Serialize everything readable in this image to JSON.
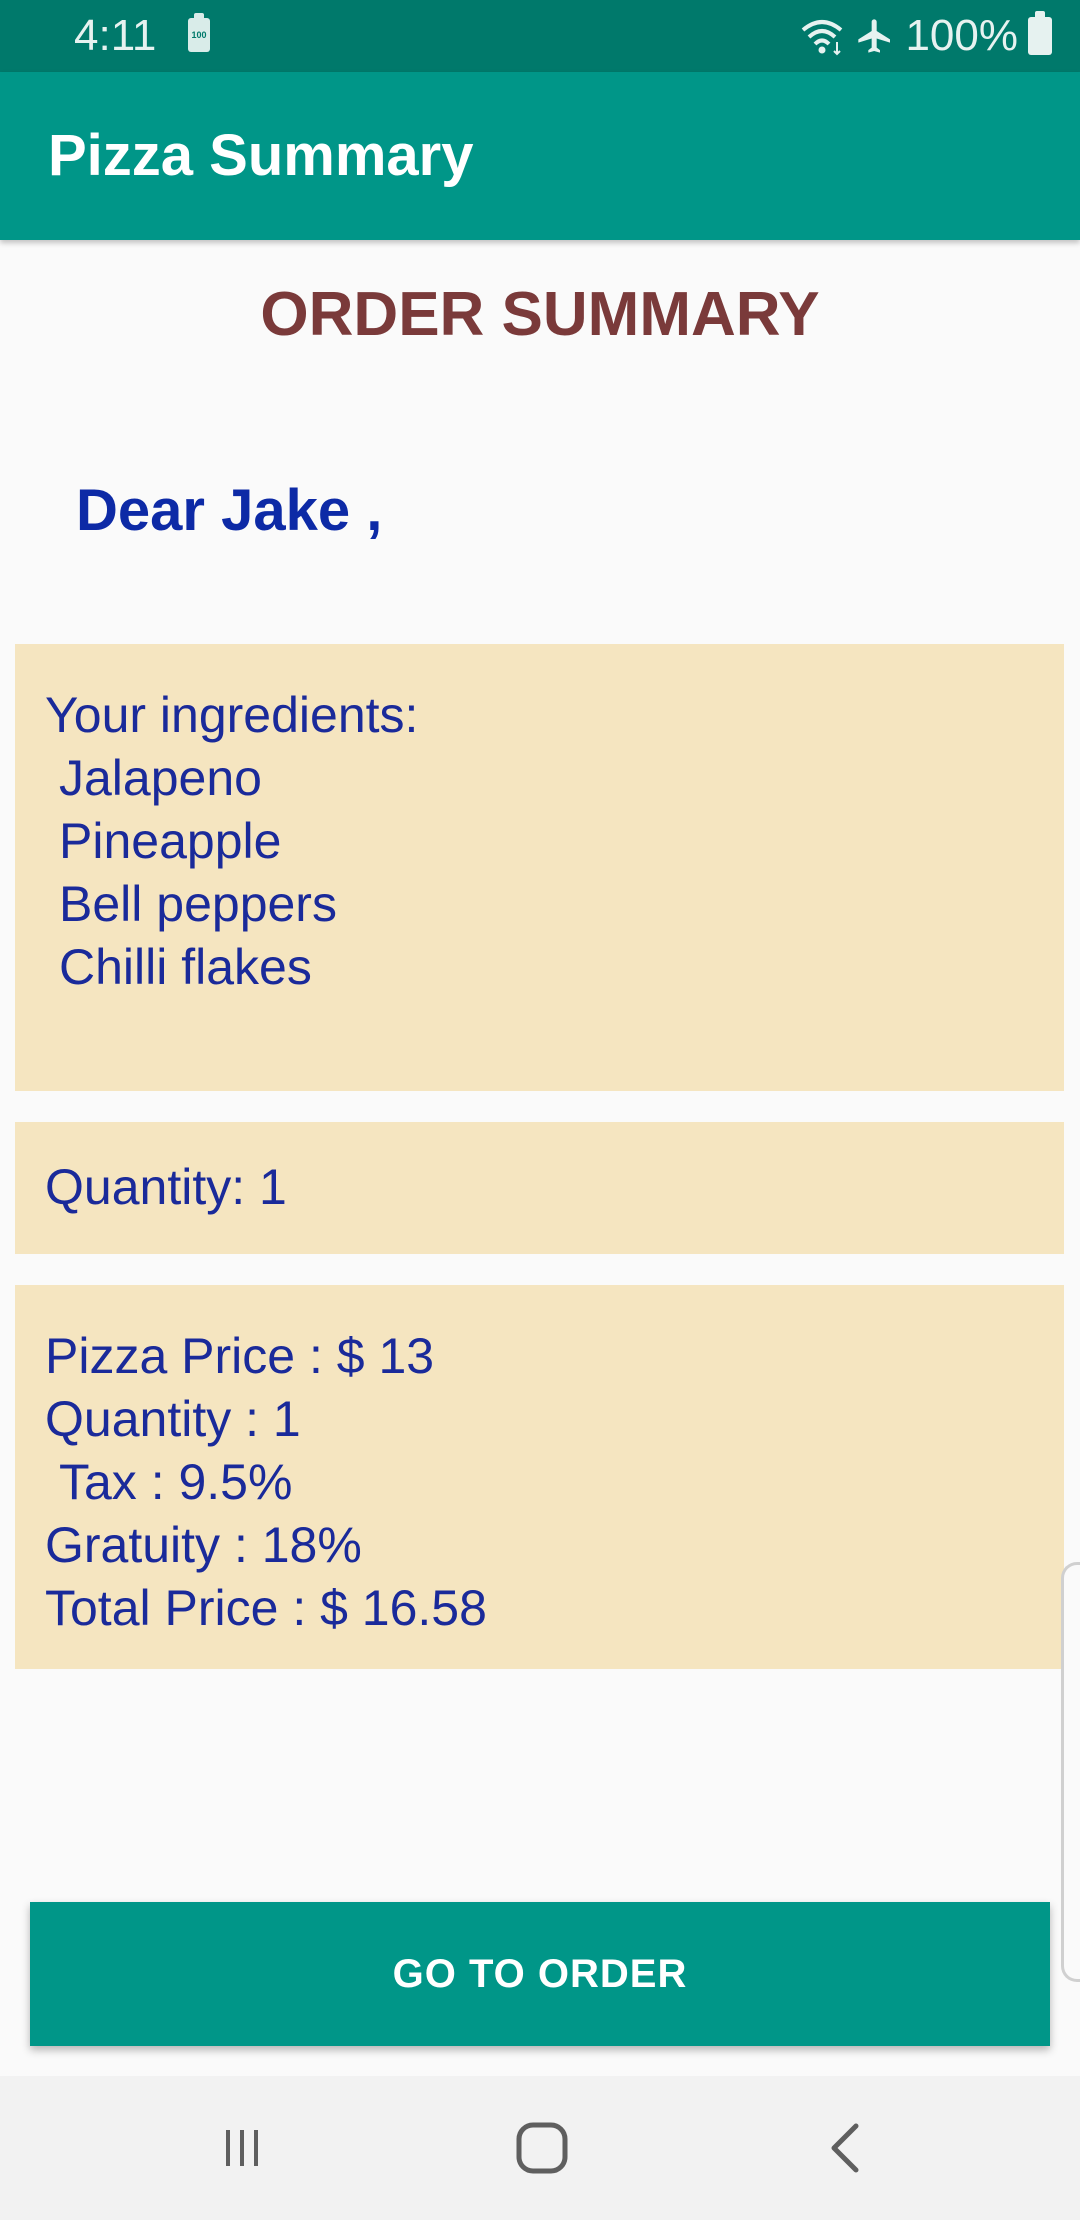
{
  "status_bar": {
    "time": "4:11",
    "battery_percent": "100%",
    "icons": [
      "battery-saver-icon",
      "wifi-icon",
      "airplane-mode-icon",
      "battery-icon"
    ]
  },
  "app_bar": {
    "title": "Pizza Summary",
    "color": "#009688"
  },
  "content": {
    "heading": "ORDER SUMMARY",
    "greeting": "Dear Jake ,"
  },
  "ingredients_card": {
    "title": "Your ingredients:",
    "items": [
      "Jalapeno",
      "Pineapple",
      "Bell peppers",
      "Chilli flakes"
    ]
  },
  "quantity_card": {
    "text": "Quantity: 1"
  },
  "price_card": {
    "pizza_price": "Pizza Price : $ 13",
    "quantity": "Quantity : 1",
    "tax": "Tax : 9.5%",
    "gratuity": "Gratuity : 18%",
    "total": "Total Price : $ 16.58"
  },
  "actions": {
    "go_to_order": "GO TO ORDER"
  },
  "nav_bar": {
    "buttons": [
      "recent-apps-icon",
      "home-icon",
      "back-icon"
    ]
  },
  "colors": {
    "primary": "#009688",
    "primary_dark": "#00796b",
    "card_background": "#f5e5c0",
    "heading": "#7a3a3a",
    "text_blue": "#1a2a9a"
  }
}
